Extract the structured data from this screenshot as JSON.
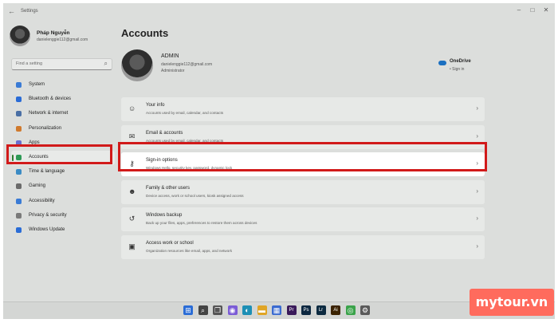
{
  "window": {
    "title": "Settings"
  },
  "user": {
    "name": "Pháp Nguyễn",
    "email": "danielenggie112@gmail.com"
  },
  "search": {
    "placeholder": "Find a setting"
  },
  "sidebar": {
    "items": [
      {
        "label": "System",
        "icon": "monitor-icon",
        "color": "#3a7bd5"
      },
      {
        "label": "Bluetooth & devices",
        "icon": "bluetooth-icon",
        "color": "#2a6cd6"
      },
      {
        "label": "Network & internet",
        "icon": "network-icon",
        "color": "#4a6fa5"
      },
      {
        "label": "Personalization",
        "icon": "brush-icon",
        "color": "#d07a2e"
      },
      {
        "label": "Apps",
        "icon": "apps-icon",
        "color": "#6a6fcf"
      },
      {
        "label": "Accounts",
        "icon": "person-icon",
        "color": "#2e9a56"
      },
      {
        "label": "Time & language",
        "icon": "clock-icon",
        "color": "#3a8bc4"
      },
      {
        "label": "Gaming",
        "icon": "gamepad-icon",
        "color": "#6a6a6a"
      },
      {
        "label": "Accessibility",
        "icon": "accessibility-icon",
        "color": "#3a7bd5"
      },
      {
        "label": "Privacy & security",
        "icon": "shield-icon",
        "color": "#7a7a7a"
      },
      {
        "label": "Windows Update",
        "icon": "update-icon",
        "color": "#2a6cd6"
      }
    ],
    "selected": "Accounts"
  },
  "main": {
    "title": "Accounts",
    "account": {
      "name": "ADMIN",
      "email": "danielenggie112@gmail.com",
      "role": "Administrator"
    },
    "onedrive": {
      "label": "OneDrive",
      "status": "• Sign in"
    },
    "cards": [
      {
        "title": "Your info",
        "subtitle": "Accounts used by email, calendar, and contacts",
        "icon": "person-icon",
        "glyph": "☺"
      },
      {
        "title": "Email & accounts",
        "subtitle": "Accounts used by email, calendar, and contacts",
        "icon": "mail-icon",
        "glyph": "✉"
      },
      {
        "title": "Sign-in options",
        "subtitle": "Windows Hello, security key, password, dynamic lock",
        "icon": "key-icon",
        "glyph": "⚷"
      },
      {
        "title": "Family & other users",
        "subtitle": "Device access, work or school users, kiosk assigned access",
        "icon": "family-icon",
        "glyph": "☻"
      },
      {
        "title": "Windows backup",
        "subtitle": "Back up your files, apps, preferences to restore them across devices",
        "icon": "backup-icon",
        "glyph": "↺"
      },
      {
        "title": "Access work or school",
        "subtitle": "Organization resources like email, apps, and network",
        "icon": "briefcase-icon",
        "glyph": "▣"
      }
    ],
    "highlighted_card": "Sign-in options"
  },
  "taskbar": {
    "icons": [
      {
        "name": "start-icon",
        "color": "#2a6cd6",
        "glyph": "⊞"
      },
      {
        "name": "search-icon",
        "color": "#444444",
        "glyph": "⌕"
      },
      {
        "name": "task-view-icon",
        "color": "#555555",
        "glyph": "❐"
      },
      {
        "name": "chat-icon",
        "color": "#7b5cd6",
        "glyph": "◉"
      },
      {
        "name": "edge-icon",
        "color": "#1d8fb5",
        "glyph": "◐"
      },
      {
        "name": "file-explorer-icon",
        "color": "#e0a526",
        "glyph": "▬"
      },
      {
        "name": "store-icon",
        "color": "#3a6ad0",
        "glyph": "▦"
      },
      {
        "name": "premiere-icon",
        "color": "#3a1a5a",
        "glyph": "Pr"
      },
      {
        "name": "photoshop-icon",
        "color": "#0c2740",
        "glyph": "Ps"
      },
      {
        "name": "lightroom-icon",
        "color": "#0c2a40",
        "glyph": "Lr"
      },
      {
        "name": "illustrator-icon",
        "color": "#3a2200",
        "glyph": "Ai"
      },
      {
        "name": "chrome-icon",
        "color": "#3aa34a",
        "glyph": "◎"
      },
      {
        "name": "settings-icon",
        "color": "#5a5a5a",
        "glyph": "⚙"
      }
    ]
  },
  "watermark": {
    "text": "mytour.vn"
  }
}
